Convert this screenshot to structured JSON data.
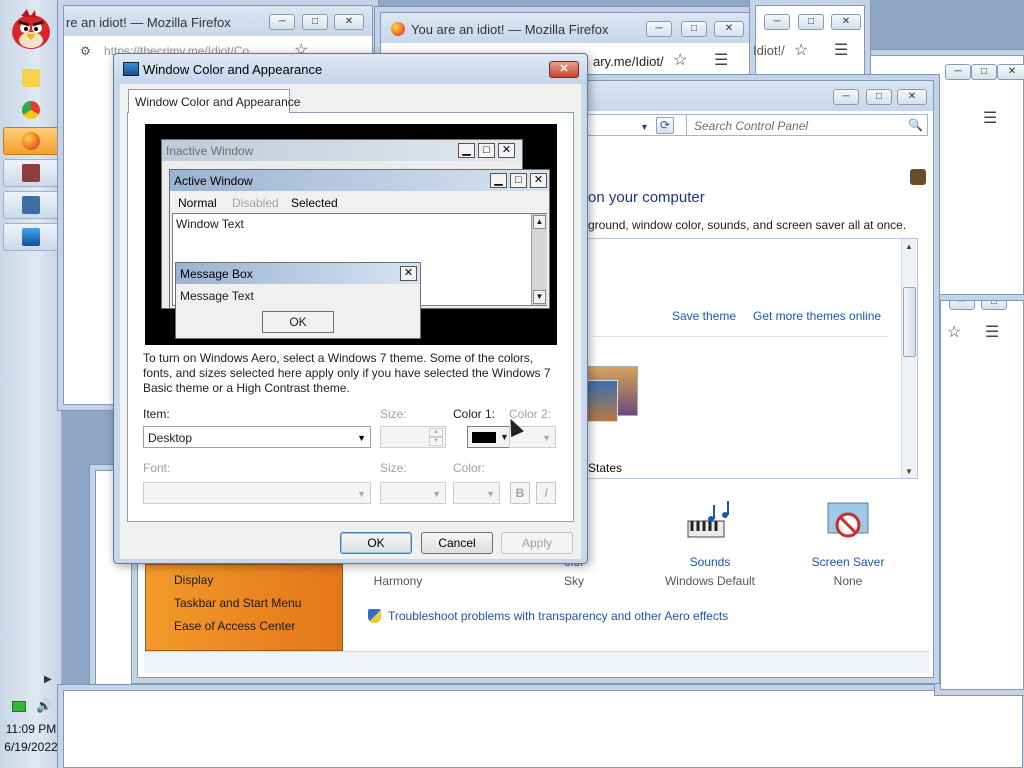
{
  "taskbar": {
    "clock_time": "11:09 PM",
    "clock_date": "6/19/2022"
  },
  "bg_windows": {
    "ff1_title": "re an idiot! — Mozilla Firefox",
    "ff1_url": "https://thecrimy.me/Idiot/Co",
    "ff2_title": "You are an idiot! — Mozilla Firefox",
    "ff2_url": "ary.me/Idiot/",
    "ff3_url": "Idiot!/"
  },
  "control_panel": {
    "search_placeholder": "Search Control Panel",
    "heading": "on your computer",
    "description": "ground, window color, sounds, and screen saver all at once.",
    "save_theme": "Save theme",
    "more_themes": "Get more themes online",
    "theme_name": "States",
    "sidebar": [
      "Display",
      "Taskbar and Start Menu",
      "Ease of Access Center"
    ],
    "bottom": {
      "color_label": "olor",
      "color_sub": "Sky",
      "harmony": "Harmony",
      "sounds_label": "Sounds",
      "sounds_sub": "Windows Default",
      "saver_label": "Screen Saver",
      "saver_sub": "None"
    },
    "troubleshoot": "Troubleshoot problems with transparency and other Aero effects"
  },
  "dialog": {
    "title": "Window Color and Appearance",
    "tab": "Window Color and Appearance",
    "preview": {
      "inactive_title": "Inactive Window",
      "active_title": "Active Window",
      "menu_normal": "Normal",
      "menu_disabled": "Disabled",
      "menu_selected": "Selected",
      "window_text": "Window Text",
      "msgbox_title": "Message Box",
      "msgbox_text": "Message Text",
      "ok": "OK"
    },
    "info": "To turn on Windows Aero, select a Windows 7 theme.  Some of the colors, fonts, and sizes selected here apply only if you have selected the Windows 7 Basic theme or a High Contrast theme.",
    "item_label": "Item:",
    "item_value": "Desktop",
    "size_label": "Size:",
    "color1_label": "Color 1:",
    "color1_value": "#000000",
    "color2_label": "Color 2:",
    "font_label": "Font:",
    "font_size_label": "Size:",
    "font_color_label": "Color:",
    "bold": "B",
    "italic": "I",
    "ok": "OK",
    "cancel": "Cancel",
    "apply": "Apply"
  }
}
